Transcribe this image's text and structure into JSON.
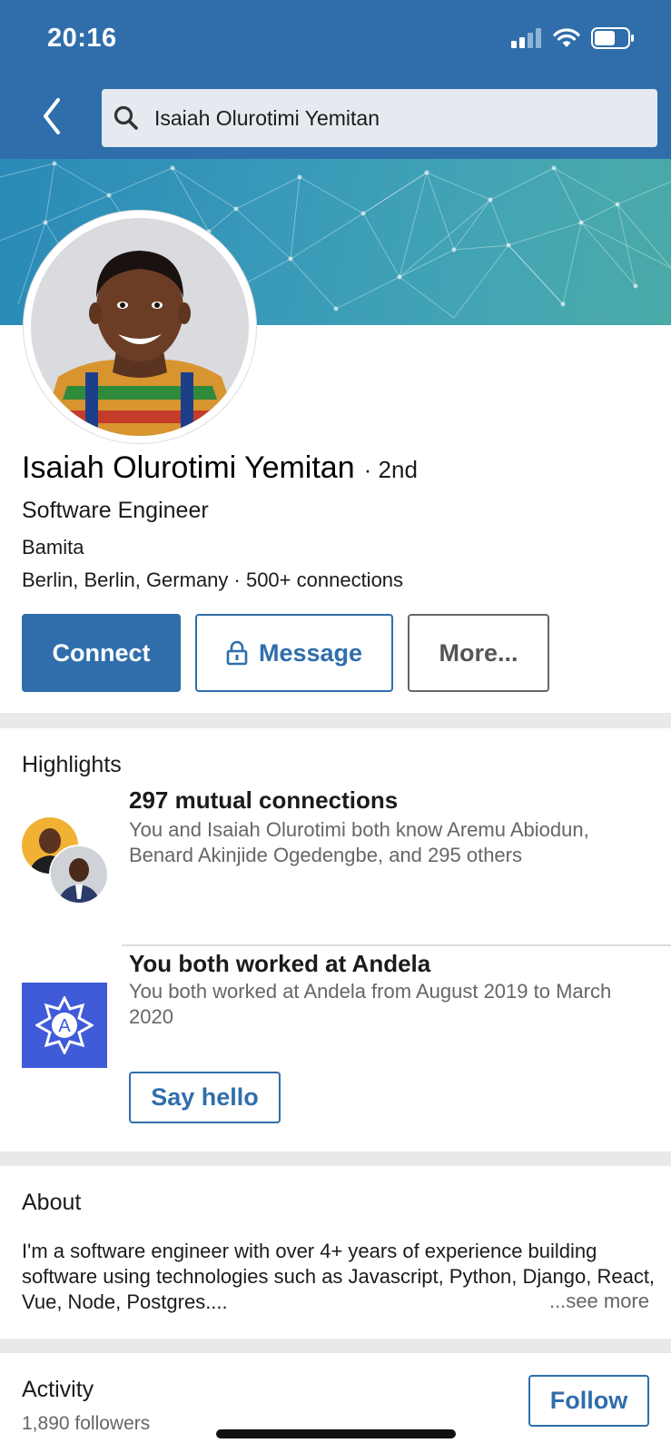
{
  "status_bar": {
    "time": "20:16"
  },
  "search": {
    "query": "Isaiah Olurotimi Yemitan"
  },
  "profile": {
    "name": "Isaiah Olurotimi Yemitan",
    "degree": "· 2nd",
    "headline": "Software Engineer",
    "company": "Bamita",
    "location_line": "Berlin, Berlin, Germany · 500+ connections"
  },
  "actions": {
    "connect": "Connect",
    "message": "Message",
    "more": "More..."
  },
  "highlights": {
    "title": "Highlights",
    "mutual": {
      "title": "297 mutual connections",
      "description": "You and Isaiah Olurotimi both know Aremu Abiodun, Benard Akinjide Ogedengbe, and 295 others"
    },
    "worked": {
      "title": "You both worked at Andela",
      "description": "You both worked at Andela from August 2019 to March 2020",
      "button": "Say hello",
      "logo_letter": "A"
    }
  },
  "about": {
    "title": "About",
    "text": "I'm a software engineer with over 4+ years of experience building software using technologies such as Javascript, Python, Django,  React, Vue, Node, Postgres....",
    "see_more": "...see more"
  },
  "activity": {
    "title": "Activity",
    "followers": "1,890 followers",
    "follow_button": "Follow"
  },
  "colors": {
    "brand_blue": "#2f6eab",
    "andela_blue": "#3f5bd8"
  }
}
